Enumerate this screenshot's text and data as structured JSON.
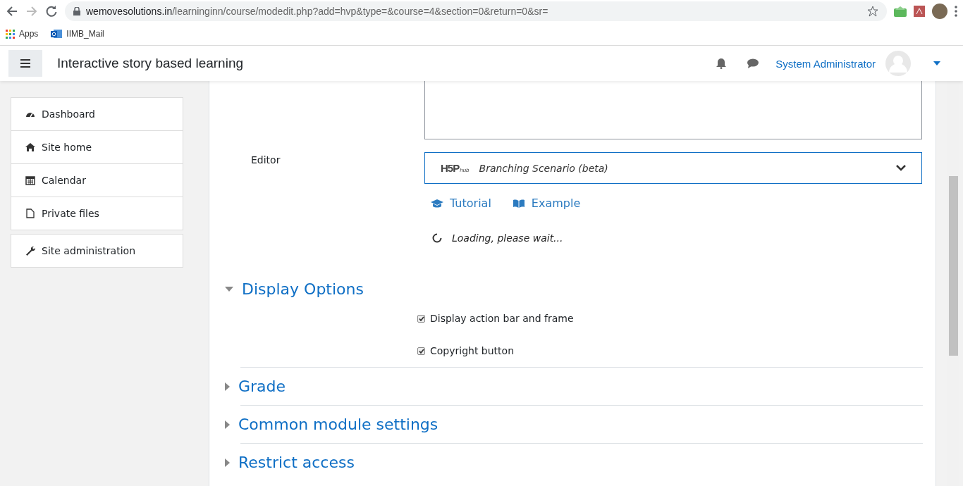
{
  "browser": {
    "url_host": "wemovesolutions.in",
    "url_path": "/learninginn/course/modedit.php?add=hvp&type=&course=4&section=0&return=0&sr=",
    "bookmarks": [
      {
        "label": "Apps",
        "kind": "apps"
      },
      {
        "label": "IIMB_Mail",
        "kind": "mail"
      }
    ]
  },
  "navbar": {
    "site_title": "Interactive story based learning",
    "user_name": "System Administrator"
  },
  "sidebar": {
    "groups": [
      [
        {
          "label": "Dashboard",
          "kind": "dashboard"
        },
        {
          "label": "Site home",
          "kind": "home"
        },
        {
          "label": "Calendar",
          "kind": "calendar"
        },
        {
          "label": "Private files",
          "kind": "file"
        }
      ],
      [
        {
          "label": "Site administration",
          "kind": "wrench"
        }
      ]
    ]
  },
  "form": {
    "editor_label": "Editor",
    "content_type": {
      "logo": "H5P",
      "logo_sub": "hub",
      "title": "Branching Scenario (beta)"
    },
    "links": [
      {
        "label": "Tutorial",
        "kind": "cap"
      },
      {
        "label": "Example",
        "kind": "book"
      }
    ],
    "loading": "Loading, please wait...",
    "sections": [
      {
        "title": "Display Options",
        "expanded": true,
        "options": [
          {
            "label": "Display action bar and frame",
            "checked": true
          },
          {
            "label": "Copyright button",
            "checked": true
          }
        ]
      },
      {
        "title": "Grade",
        "expanded": false
      },
      {
        "title": "Common module settings",
        "expanded": false
      },
      {
        "title": "Restrict access",
        "expanded": false
      }
    ]
  }
}
